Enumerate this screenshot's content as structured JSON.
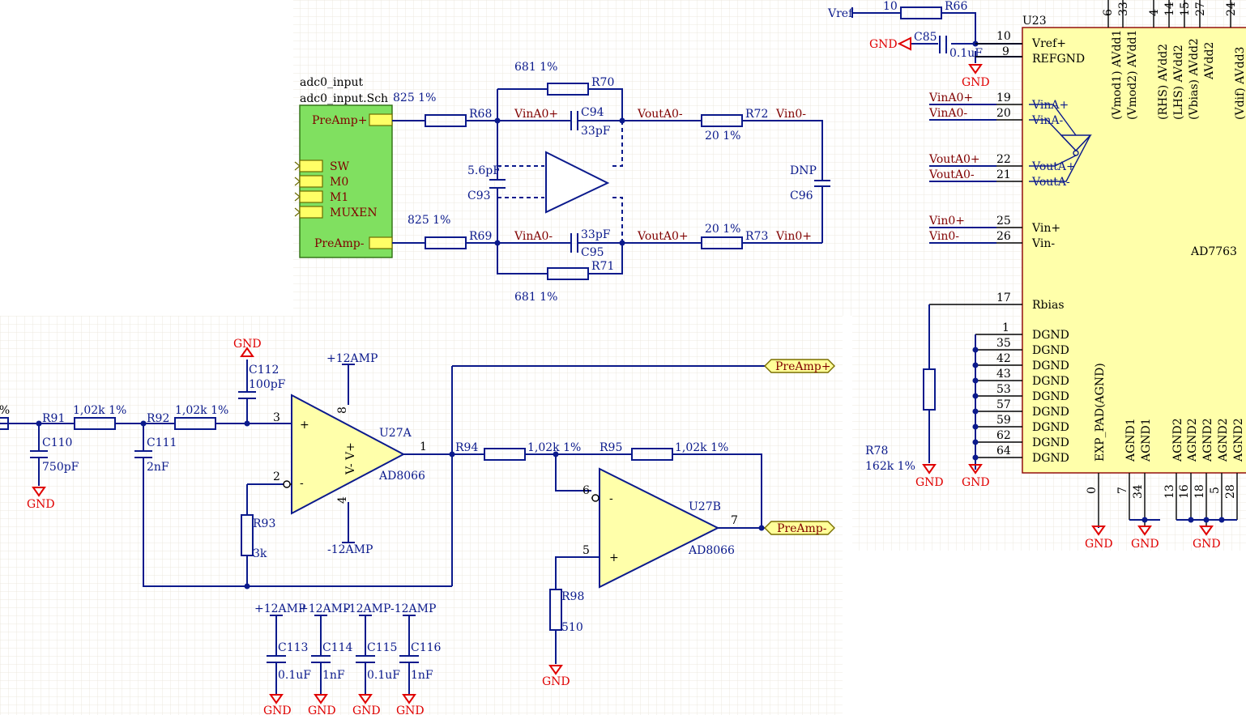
{
  "sheet_symbol": {
    "designator": "adc0_input",
    "filename": "adc0_input.Sch",
    "pins": [
      "PreAmp+",
      "SW",
      "M0",
      "M1",
      "MUXEN",
      "PreAmp-"
    ]
  },
  "input_filter": {
    "r68": {
      "ref": "R68",
      "value": "825 1%"
    },
    "r69": {
      "ref": "R69",
      "value": "825 1%"
    },
    "r70": {
      "ref": "R70",
      "value": "681 1%"
    },
    "r71": {
      "ref": "R71",
      "value": "681 1%"
    },
    "r72": {
      "ref": "R72",
      "value": "20 1%"
    },
    "r73": {
      "ref": "R73",
      "value": "20 1%"
    },
    "c93": {
      "ref": "C93",
      "value": "5.6pF"
    },
    "c94": {
      "ref": "C94",
      "value": "33pF"
    },
    "c95": {
      "ref": "C95",
      "value": "33pF"
    },
    "c96": {
      "ref": "C96",
      "value": "DNP"
    },
    "nets": {
      "vina_plus": "VinA0+",
      "vina_minus": "VinA0-",
      "vouta_minus": "VoutA0-",
      "vouta_plus": "VoutA0+",
      "vin0_minus": "Vin0-",
      "vin0_plus": "Vin0+"
    }
  },
  "adc": {
    "ref": "U23",
    "part": "AD7763",
    "top_pin_numbers": [
      "6",
      "33",
      "4",
      "14",
      "15",
      "27",
      "24"
    ],
    "top_pin_names": [
      "(Vmod1) AVdd1",
      "(Vmod2) AVdd1",
      "(RHS) AVdd2",
      "(LHS) AVdd2",
      "(Vbias) AVdd2",
      "AVdd2",
      "(Vdif) AVdd3"
    ],
    "left_pins": [
      {
        "num": "10",
        "name": "Vref+"
      },
      {
        "num": "9",
        "name": "REFGND"
      },
      {
        "num": "19",
        "name": "VinA+",
        "net": "VinA0+"
      },
      {
        "num": "20",
        "name": "VinA-",
        "net": "VinA0-"
      },
      {
        "num": "22",
        "name": "VoutA+",
        "net": "VoutA0+"
      },
      {
        "num": "21",
        "name": "VoutA-",
        "net": "VoutA0-"
      },
      {
        "num": "25",
        "name": "Vin+",
        "net": "Vin0+"
      },
      {
        "num": "26",
        "name": "Vin-",
        "net": "Vin0-"
      },
      {
        "num": "17",
        "name": "Rbias"
      }
    ],
    "dgnd_pins": [
      "1",
      "35",
      "42",
      "43",
      "53",
      "57",
      "59",
      "62",
      "64"
    ],
    "dgnd_name": "DGND",
    "bottom_pin_numbers": [
      "0",
      "7",
      "34",
      "13",
      "16",
      "18",
      "5",
      "28"
    ],
    "bottom_pin_names": [
      "EXP_PAD(AGND)",
      "AGND1",
      "AGND1",
      "AGND2",
      "AGND2",
      "AGND2",
      "AGND2",
      "AGND2"
    ]
  },
  "reference": {
    "net_vref": "Vref",
    "r66": {
      "ref": "R66",
      "value": "10"
    },
    "c85": {
      "ref": "C85",
      "value": "0.1uF"
    }
  },
  "r78": {
    "ref": "R78",
    "value": "162k 1%"
  },
  "gnd_label": "GND",
  "preamp": {
    "partial_left_value": "1%",
    "r91": {
      "ref": "R91",
      "value": "1,02k 1%"
    },
    "r92": {
      "ref": "R92",
      "value": "1,02k 1%"
    },
    "r93": {
      "ref": "R93",
      "value": "3k"
    },
    "r94": {
      "ref": "R94",
      "value": "1,02k 1%"
    },
    "r95": {
      "ref": "R95",
      "value": "1,02k 1%"
    },
    "r98": {
      "ref": "R98",
      "value": "510"
    },
    "c110": {
      "ref": "C110",
      "value": "750pF"
    },
    "c111": {
      "ref": "C111",
      "value": "2nF"
    },
    "c112": {
      "ref": "C112",
      "value": "100pF"
    },
    "u27a": {
      "ref": "U27A",
      "part": "AD8066",
      "pin_plus": "3",
      "pin_minus": "2",
      "pin_out": "1",
      "pin_vp": "8",
      "pin_vm": "4",
      "sup_label": "V- V+"
    },
    "u27b": {
      "ref": "U27B",
      "part": "AD8066",
      "pin_plus": "5",
      "pin_minus": "6",
      "pin_out": "7"
    },
    "plus_sign": "+",
    "minus_sign": "-",
    "rail_pos": "+12AMP",
    "rail_neg": "-12AMP",
    "port_pos": "PreAmp+",
    "port_neg": "PreAmp-"
  },
  "decoupling": [
    {
      "rail": "+12AMP",
      "ref": "C113",
      "value": "0.1uF"
    },
    {
      "rail": "+12AMP",
      "ref": "C114",
      "value": "1nF"
    },
    {
      "rail": "-12AMP",
      "ref": "C115",
      "value": "0.1uF"
    },
    {
      "rail": "-12AMP",
      "ref": "C116",
      "value": "1nF"
    }
  ]
}
